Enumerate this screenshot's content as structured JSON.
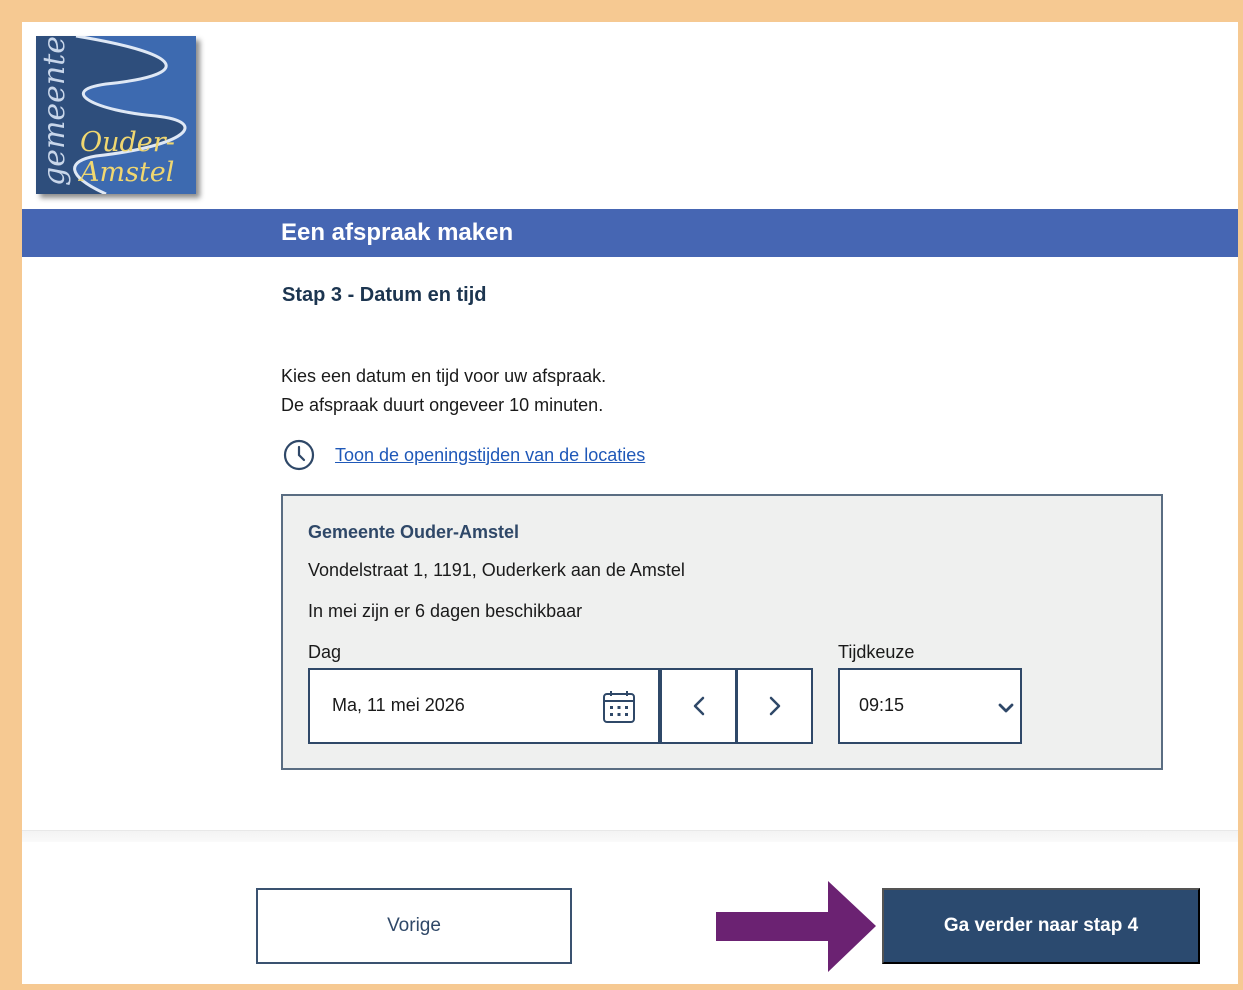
{
  "logo": {
    "vertical_text": "gemeente",
    "name_line1": "Ouder-",
    "name_line2": "Amstel"
  },
  "header": {
    "title": "Een afspraak maken"
  },
  "step": {
    "title": "Stap 3 - Datum en tijd"
  },
  "intro": {
    "line1": "Kies een datum en tijd voor uw afspraak.",
    "line2": "De afspraak duurt ongeveer 10 minuten."
  },
  "hours_link": {
    "icon": "clock-icon",
    "label": "Toon de openingstijden van de locaties"
  },
  "location": {
    "name": "Gemeente Ouder-Amstel",
    "address": "Vondelstraat 1, 1191, Ouderkerk aan de Amstel",
    "availability": "In mei zijn er 6 dagen beschikbaar",
    "day_label": "Dag",
    "day_value": "Ma, 11 mei 2026",
    "time_label": "Tijdkeuze",
    "time_value": "09:15"
  },
  "footer": {
    "prev_label": "Vorige",
    "next_label": "Ga verder naar stap 4"
  },
  "colors": {
    "frame": "#f6c992",
    "header_bar": "#4666b3",
    "primary_button": "#2b4a6f",
    "link": "#1f58b8",
    "annotation_arrow": "#6b2272"
  }
}
